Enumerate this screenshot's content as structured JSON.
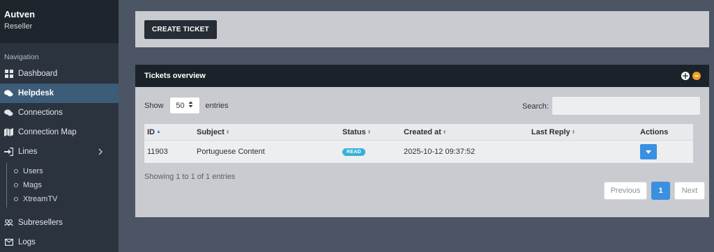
{
  "brand": {
    "name": "Autven",
    "role": "Reseller"
  },
  "nav_title": "Navigation",
  "nav": {
    "dashboard": "Dashboard",
    "helpdesk": "Helpdesk",
    "connections": "Connections",
    "connection_map": "Connection Map",
    "lines": "Lines",
    "lines_sub": [
      "Users",
      "Mags",
      "XtreamTV"
    ],
    "subresellers": "Subresellers",
    "logs": "Logs"
  },
  "toolbar": {
    "create_ticket": "CREATE TICKET"
  },
  "tickets": {
    "title": "Tickets overview",
    "show_label": "Show",
    "entries_value": "50",
    "entries_label": "entries",
    "search_label": "Search:",
    "search_value": "",
    "columns": [
      "ID",
      "Subject",
      "Status",
      "Created at",
      "Last Reply",
      "Actions"
    ],
    "rows": [
      {
        "id": "11903",
        "subject": "Portuguese Content",
        "status": "READ",
        "created_at": "2025-10-12 09:37:52",
        "last_reply": ""
      }
    ],
    "info": "Showing 1 to 1 of 1 entries",
    "pager": {
      "previous": "Previous",
      "page": "1",
      "next": "Next"
    }
  },
  "colors": {
    "accent": "#3a8fe0",
    "badge": "#39b0d8",
    "sidebar": "#2b333e",
    "active_nav": "#3c5c78"
  }
}
